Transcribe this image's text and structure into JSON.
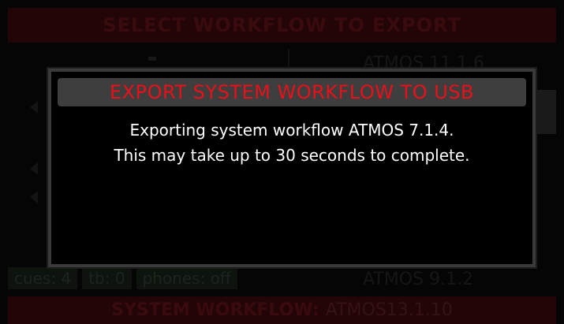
{
  "background": {
    "title": "SELECT WORKFLOW TO EXPORT",
    "list_items": [
      "ATMOS 11.1.6",
      "ATMOS 9.1.2"
    ],
    "status": {
      "cues": "cues: 4",
      "tb": "tb: 0",
      "phones": "phones: off"
    },
    "footer": {
      "label": "SYSTEM WORKFLOW:",
      "value": "ATMOS13.1.10"
    },
    "icons": [
      "speaker-icon",
      "speaker-icon",
      "speaker-icon"
    ]
  },
  "dialog": {
    "title": "EXPORT SYSTEM WORKFLOW TO USB",
    "line1": "Exporting system workflow ATMOS 7.1.4.",
    "line2": "This may take up to 30 seconds to complete."
  },
  "colors": {
    "dialog_title": "#e8101a",
    "dialog_header_bg": "#3e3e3e",
    "dialog_border": "#3a3a3a",
    "body_text": "#ffffff",
    "bar_bg": "#240507"
  }
}
